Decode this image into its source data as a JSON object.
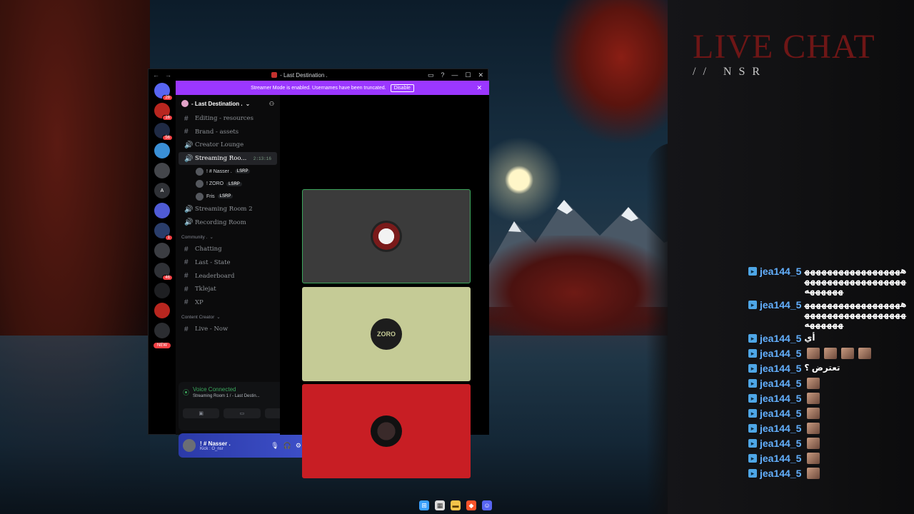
{
  "overlay": {
    "title": "LIVE CHAT",
    "subtitle": "// NSR"
  },
  "chat": [
    {
      "user": "jea144_5",
      "message": "ﻫﻬﻬﻬﻬﻬﻬﻬﻬﻬﻬﻬﻬﻬﻬﻬﻬﻬﻬﻬﻬﻬﻬﻬﻬﻬﻬﻬﻬﻬﻬﻬﻬﻬﻬﻬﻬﻬﻬﻬﻬﻬﻪ"
    },
    {
      "user": "jea144_5",
      "message": "ﻫﻬﻬﻬﻬﻬﻬﻬﻬﻬﻬﻬﻬﻬﻬﻬﻬﻬﻬﻬﻬﻬﻬﻬﻬﻬﻬﻬﻬﻬﻬﻬﻬﻬﻬﻬﻬﻬﻬﻬﻬﻬﻪ"
    },
    {
      "user": "jea144_5",
      "message": "أي"
    },
    {
      "user": "jea144_5",
      "message": "",
      "emotes": 4
    },
    {
      "user": "jea144_5",
      "message": "تعترض ؟"
    },
    {
      "user": "jea144_5",
      "message": "",
      "emotes": 1
    },
    {
      "user": "jea144_5",
      "message": "",
      "emotes": 1
    },
    {
      "user": "jea144_5",
      "message": "",
      "emotes": 1
    },
    {
      "user": "jea144_5",
      "message": "",
      "emotes": 1
    },
    {
      "user": "jea144_5",
      "message": "",
      "emotes": 1
    },
    {
      "user": "jea144_5",
      "message": "",
      "emotes": 1
    },
    {
      "user": "jea144_5",
      "message": "",
      "emotes": 1
    }
  ],
  "window": {
    "title": "- Last Destination .",
    "banner_text": "Streamer Mode is enabled. Usernames have been truncated.",
    "banner_button": "Disable"
  },
  "servers": [
    {
      "label": "",
      "badge": "28"
    },
    {
      "label": "",
      "badge": "16"
    },
    {
      "label": "",
      "badge": "56"
    },
    {
      "label": "",
      "badge": ""
    },
    {
      "label": "",
      "badge": ""
    },
    {
      "label": "A",
      "badge": ""
    },
    {
      "label": "",
      "badge": ""
    },
    {
      "label": "",
      "badge": "1"
    },
    {
      "label": "",
      "badge": ""
    },
    {
      "label": "",
      "badge": "46"
    },
    {
      "label": "",
      "badge": ""
    },
    {
      "label": "",
      "badge": ""
    },
    {
      "label": "",
      "badge": ""
    }
  ],
  "server_new_label": "NEW",
  "server_name": "- Last Destination .",
  "channels_top": [
    {
      "name": "Editing - resources",
      "icon": "#"
    },
    {
      "name": "Brand - assets",
      "icon": "#"
    },
    {
      "name": "Creator Lounge",
      "icon": "speaker"
    },
    {
      "name": "Streaming Roo...",
      "icon": "speaker",
      "active": true,
      "timer": "2:13:16"
    }
  ],
  "voice_users": [
    {
      "name": "! # Nasser .",
      "tag": "LSRP"
    },
    {
      "name": "! ZORO",
      "tag": "LSRP"
    },
    {
      "name": "Fris",
      "tag": "LSRP"
    }
  ],
  "channels_mid": [
    {
      "name": "Streaming Room 2",
      "icon": "speaker"
    },
    {
      "name": "Recording Room",
      "icon": "speaker"
    }
  ],
  "category_community": "Community .",
  "channels_community": [
    {
      "name": "Chatting"
    },
    {
      "name": "Last - State"
    },
    {
      "name": "Leaderboard"
    },
    {
      "name": "Tklejat"
    },
    {
      "name": "XP"
    }
  ],
  "category_creator": "Content Creator",
  "channels_creator": [
    {
      "name": "Live - Now"
    }
  ],
  "voice_panel": {
    "status": "Voice Connected",
    "location": "Streaming Room 1 / - Last Destin..."
  },
  "user_panel": {
    "name": "! # Nasser .",
    "status": "Kick : O_nsr"
  },
  "tiles": [
    {
      "label": "",
      "bg": "#3b3b3b",
      "border": "#3ba55c"
    },
    {
      "label": "ZORO",
      "bg": "#c5cb96",
      "border": ""
    },
    {
      "label": "",
      "bg": "#c81e24",
      "border": ""
    }
  ],
  "colors": {
    "banner": "#9b37ff",
    "chat_user": "#63b0ff",
    "voice_green": "#3ba55c"
  }
}
